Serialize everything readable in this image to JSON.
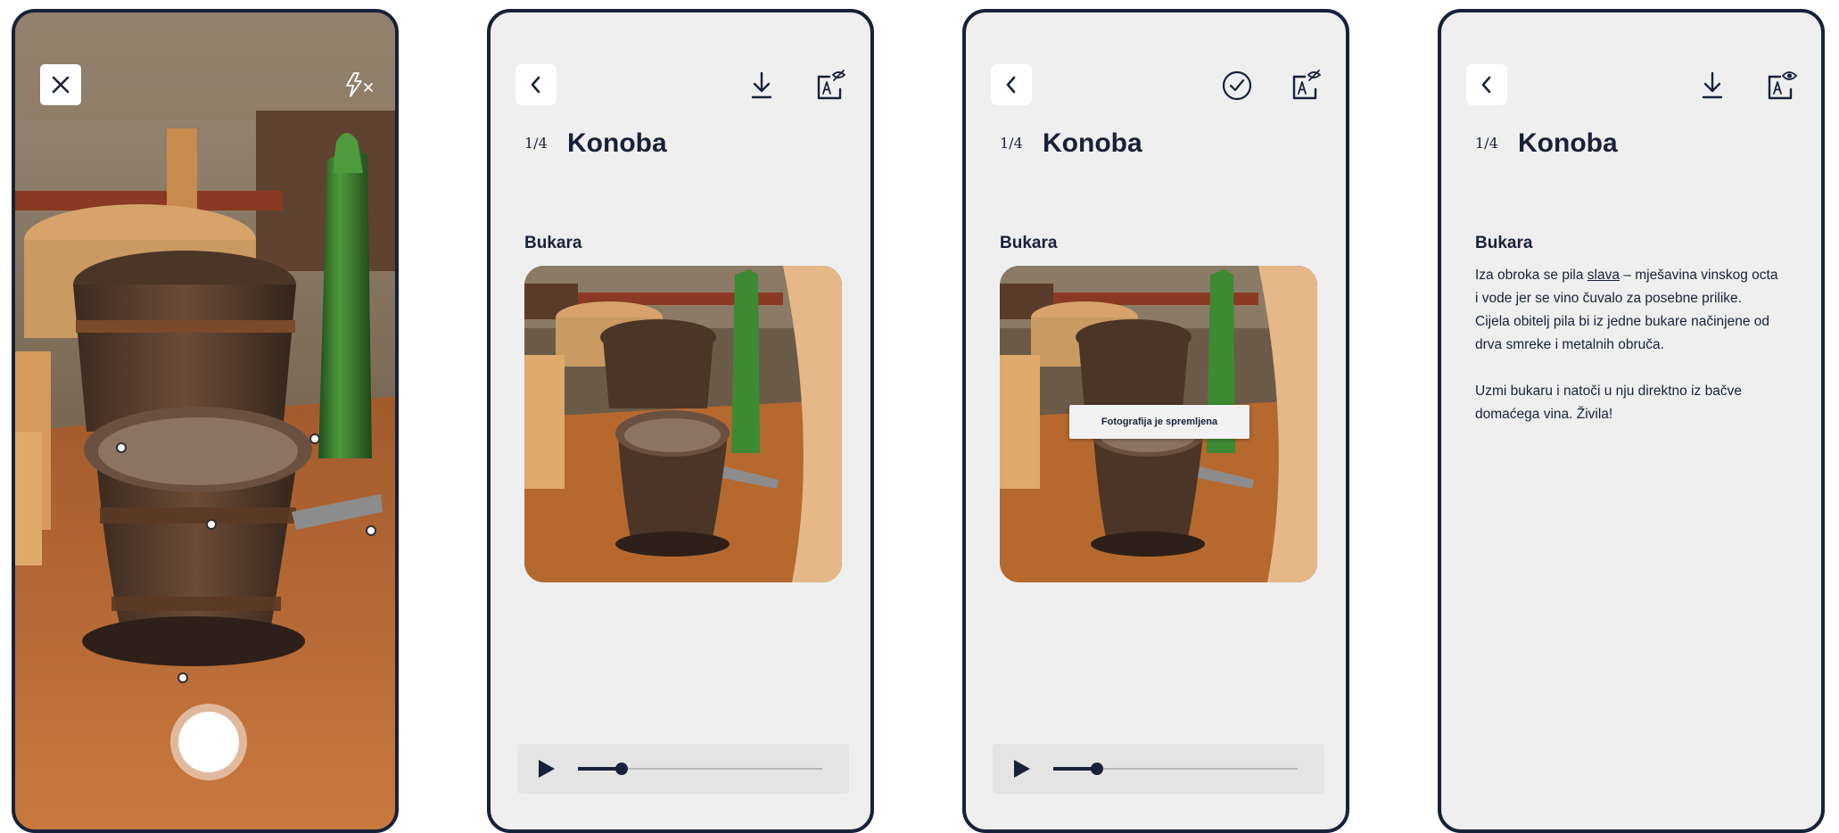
{
  "camera_screen": {
    "close_icon": "close-icon",
    "flash_icon": "flash-off-icon",
    "shutter_icon": "shutter-button"
  },
  "screens": {
    "counter": "1/4",
    "title": "Konoba",
    "item_title": "Bukara",
    "saved_toast": "Fotografija je spremljena",
    "icons": {
      "back": "chevron-left-icon",
      "download": "download-icon",
      "saved": "check-circle-icon",
      "text_mode": "text-view-icon",
      "play": "play-icon"
    },
    "audio_progress": 0.18
  },
  "description": {
    "p1_before": "Iza obroka se pila ",
    "p1_link": "slava",
    "p1_after": " – mješavina vinskog octa i vode jer se vino čuvalo za posebne prilike. Cijela obitelj pila bi iz jedne bukare načinjene od drva smreke i metalnih obruča.",
    "p2": "Uzmi bukaru i natoči u nju direktno iz bačve domaćega vina. Živila!"
  },
  "colors": {
    "navy": "#17213a",
    "screen_bg": "#efefef",
    "player_bg": "#e4e4e4"
  }
}
